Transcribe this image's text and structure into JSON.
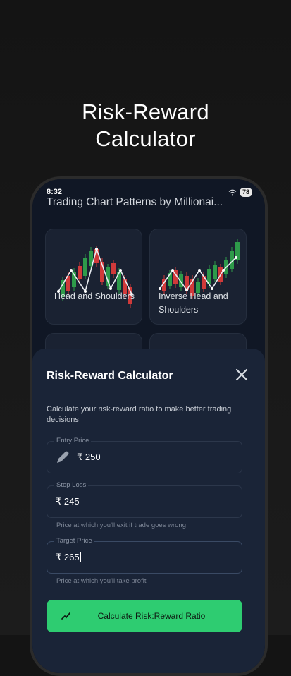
{
  "promo": {
    "title": "Risk-Reward\nCalculator"
  },
  "status_bar": {
    "time": "8:32",
    "battery": "78"
  },
  "app": {
    "title": "Trading Chart Patterns by Millionai..."
  },
  "cards": [
    {
      "label": "Head and Shoulders"
    },
    {
      "label": "Inverse Head and Shoulders"
    }
  ],
  "calculator": {
    "title": "Risk-Reward Calculator",
    "description": "Calculate your risk-reward ratio to make better trading decisions",
    "entry": {
      "label": "Entry Price",
      "value": "₹ 250"
    },
    "stop_loss": {
      "label": "Stop Loss",
      "value": "₹ 245",
      "helper": "Price at which you'll exit if trade goes wrong"
    },
    "target": {
      "label": "Target Price",
      "value": "₹ 265",
      "helper": "Price at which you'll take profit"
    },
    "button_label": "Calculate Risk:Reward Ratio"
  },
  "colors": {
    "accent": "#2ecc71",
    "bull": "#2e9b4a",
    "bear": "#d03a3a",
    "sheet": "#1a2437"
  }
}
